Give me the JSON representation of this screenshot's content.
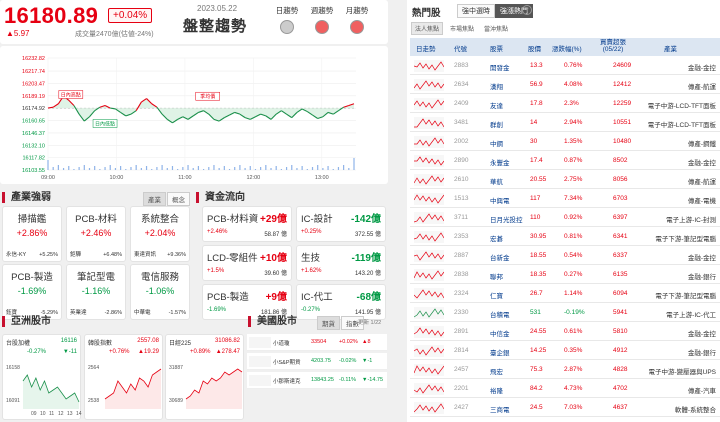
{
  "header": {
    "price": "16180.89",
    "pct": "+0.04%",
    "change": "▲5.97",
    "volume": "成交量2470億(估値-24%)",
    "date": "2023.05.22",
    "title": "盤整趨勢",
    "trends": [
      {
        "label": "日趨勢",
        "color": "#cccccc"
      },
      {
        "label": "週趨勢",
        "color": "#f06060"
      },
      {
        "label": "月趨勢",
        "color": "#f06060"
      }
    ]
  },
  "chart_data": {
    "type": "line",
    "title": "",
    "y_ticks": [
      "16232.82",
      "16217.74",
      "16203.47",
      "16189.19",
      "16174.92",
      "16160.65",
      "16146.37",
      "16132.10",
      "16117.82",
      "16103.55"
    ],
    "x_ticks": [
      "09:00",
      "10:00",
      "11:00",
      "12:00",
      "13:00"
    ],
    "ylim": [
      16103.55,
      16232.82
    ],
    "reference": 16174.92,
    "markers": [
      {
        "label": "日內高點",
        "time": "09:20",
        "value": 16178
      },
      {
        "label": "日內低點",
        "time": "09:50",
        "value": 16163
      },
      {
        "label": "季均價",
        "time": "11:20",
        "value": 16176
      }
    ],
    "series": [
      {
        "values": [
          16175,
          16176,
          16180,
          16189,
          16184,
          16178,
          16168,
          16160,
          16165,
          16172,
          16176,
          16178,
          16175,
          16174,
          16170,
          16166,
          16168,
          16172,
          16182,
          16186,
          16180,
          16176,
          16168,
          16162,
          16158,
          16162,
          16165,
          16162,
          16166,
          16170,
          16172,
          16168,
          16162,
          16160,
          16164,
          16167,
          16170,
          16168,
          16164,
          16162,
          16165,
          16168,
          16166,
          16162,
          16168,
          16172,
          16168,
          16164,
          16170,
          16174,
          16171,
          16167,
          16163,
          16165,
          16170,
          16168,
          16172,
          16176,
          16178,
          16180
        ]
      }
    ]
  },
  "industry": {
    "title": "產業強弱",
    "tabs": [
      "產業",
      "概念"
    ],
    "boxes": [
      {
        "name": "掃描鑑",
        "pct": "+2.86%",
        "l": "永信-KY",
        "lp": "+5.25%",
        "r": "",
        "rp": ""
      },
      {
        "name": "PCB-材料",
        "pct": "+2.46%",
        "l": "鉅驊",
        "lp": "+6.48%",
        "r": "",
        "rp": ""
      },
      {
        "name": "系統整合",
        "pct": "+2.04%",
        "l": "東達資訊",
        "lp": "+9.36%",
        "r": "",
        "rp": ""
      },
      {
        "name": "PCB-製造",
        "pct": "-1.69%",
        "l": "鈺寶",
        "lp": "-5.29%",
        "r": "",
        "rp": ""
      },
      {
        "name": "筆記型電",
        "pct": "-1.16%",
        "l": "英業達",
        "lp": "-2.86%",
        "r": "",
        "rp": ""
      },
      {
        "name": "電信服務",
        "pct": "-1.06%",
        "l": "中華電",
        "lp": "-1.57%",
        "r": "",
        "rp": ""
      }
    ]
  },
  "fund": {
    "title": "資金流向",
    "boxes": [
      {
        "name": "PCB-材料資",
        "val": "+29億",
        "pct": "+2.46%",
        "amt": "58.87 億"
      },
      {
        "name": "IC-設計",
        "val": "-142億",
        "pct": "+0.25%",
        "amt": "372.55 億"
      },
      {
        "name": "LCD-零組件",
        "val": "+10億",
        "pct": "+1.5%",
        "amt": "39.60 億"
      },
      {
        "name": "生技",
        "val": "-119億",
        "pct": "+1.62%",
        "amt": "143.20 億"
      },
      {
        "name": "PCB-製造",
        "val": "+9億",
        "pct": "-1.69%",
        "amt": "181.86 億"
      },
      {
        "name": "IC-代工",
        "val": "-68億",
        "pct": "-0.27%",
        "amt": "141.95 億"
      }
    ]
  },
  "asia": {
    "title": "亞洲股市",
    "charts": [
      {
        "name": "台股加權",
        "val": "16116",
        "pct": "-0.27%",
        "chg": "▼-11",
        "hi": "16158",
        "lo": "16091",
        "x": [
          "09",
          "10",
          "11",
          "12",
          "13",
          "14"
        ]
      },
      {
        "name": "韓股指數",
        "val": "2557.08",
        "pct": "+0.76%",
        "chg": "▲19.29",
        "hi": "2564",
        "lo": "2538",
        "x": []
      },
      {
        "name": "日經225",
        "val": "31086.82",
        "pct": "+0.89%",
        "chg": "▲278.47",
        "hi": "31887",
        "lo": "30689",
        "x": []
      }
    ]
  },
  "us": {
    "title": "美國股市",
    "tabs": [
      "期貨",
      "指數"
    ],
    "updated": "更新 1/22",
    "rows": [
      {
        "name": "小道瓊",
        "val": "33504",
        "pct": "+0.02%",
        "chg": "▲8"
      },
      {
        "name": "小S&P期貨",
        "val": "4203.75",
        "pct": "-0.02%",
        "chg": "▼-1"
      },
      {
        "name": "小那斯達克",
        "val": "13843.25",
        "pct": "-0.11%",
        "chg": "▼-14.75"
      }
    ]
  },
  "hot": {
    "title": "熱門股",
    "tabs": [
      "強中選時",
      "強漲熱門"
    ],
    "subtabs": [
      "法人焦點",
      "市場焦點",
      "當沖焦點"
    ],
    "cols": [
      "日走勢",
      "代號",
      "股票",
      "股價",
      "漲跌幅(%)",
      "買賣超張(05/22)",
      "產業"
    ],
    "rows": [
      {
        "code": "2883",
        "name": "開發金",
        "price": "13.3",
        "pct": "0.76%",
        "vol": "24609",
        "ind": "金融-金控"
      },
      {
        "code": "2634",
        "name": "漢翔",
        "price": "56.9",
        "pct": "4.08%",
        "vol": "12412",
        "ind": "傳產-航運"
      },
      {
        "code": "2409",
        "name": "友達",
        "price": "17.8",
        "pct": "2.3%",
        "vol": "12259",
        "ind": "電子中游-LCD-TFT面板"
      },
      {
        "code": "3481",
        "name": "群創",
        "price": "14",
        "pct": "2.94%",
        "vol": "10551",
        "ind": "電子中游-LCD-TFT面板"
      },
      {
        "code": "2002",
        "name": "中鋼",
        "price": "30",
        "pct": "1.35%",
        "vol": "10480",
        "ind": "傳產-鋼鐵"
      },
      {
        "code": "2890",
        "name": "永豐金",
        "price": "17.4",
        "pct": "0.87%",
        "vol": "8502",
        "ind": "金融-金控"
      },
      {
        "code": "2610",
        "name": "華航",
        "price": "20.55",
        "pct": "2.75%",
        "vol": "8056",
        "ind": "傳產-航運"
      },
      {
        "code": "1513",
        "name": "中興電",
        "price": "117",
        "pct": "7.34%",
        "vol": "6703",
        "ind": "傳產-電機"
      },
      {
        "code": "3711",
        "name": "日月光投控",
        "price": "110",
        "pct": "0.92%",
        "vol": "6397",
        "ind": "電子上游-IC-封測"
      },
      {
        "code": "2353",
        "name": "宏碁",
        "price": "30.95",
        "pct": "0.81%",
        "vol": "6341",
        "ind": "電子下游-筆記型電腦"
      },
      {
        "code": "2887",
        "name": "台新金",
        "price": "18.55",
        "pct": "0.54%",
        "vol": "6337",
        "ind": "金融-金控"
      },
      {
        "code": "2838",
        "name": "聯邦",
        "price": "18.35",
        "pct": "0.27%",
        "vol": "6135",
        "ind": "金融-銀行"
      },
      {
        "code": "2324",
        "name": "仁寶",
        "price": "26.7",
        "pct": "1.14%",
        "vol": "6094",
        "ind": "電子下游-筆記型電腦"
      },
      {
        "code": "2330",
        "name": "台積電",
        "price": "531",
        "pct": "-0.19%",
        "vol": "5941",
        "ind": "電子上游-IC-代工"
      },
      {
        "code": "2891",
        "name": "中信金",
        "price": "24.55",
        "pct": "0.61%",
        "vol": "5810",
        "ind": "金融-金控"
      },
      {
        "code": "2814",
        "name": "臺企銀",
        "price": "14.25",
        "pct": "0.35%",
        "vol": "4912",
        "ind": "金融-銀行"
      },
      {
        "code": "2457",
        "name": "飛宏",
        "price": "75.3",
        "pct": "2.87%",
        "vol": "4828",
        "ind": "電子中游-變壓器與UPS"
      },
      {
        "code": "2201",
        "name": "裕隆",
        "price": "84.2",
        "pct": "4.73%",
        "vol": "4702",
        "ind": "傳產-汽車"
      },
      {
        "code": "2427",
        "name": "三商電",
        "price": "24.5",
        "pct": "7.03%",
        "vol": "4637",
        "ind": "軟體-系統整合"
      }
    ]
  }
}
